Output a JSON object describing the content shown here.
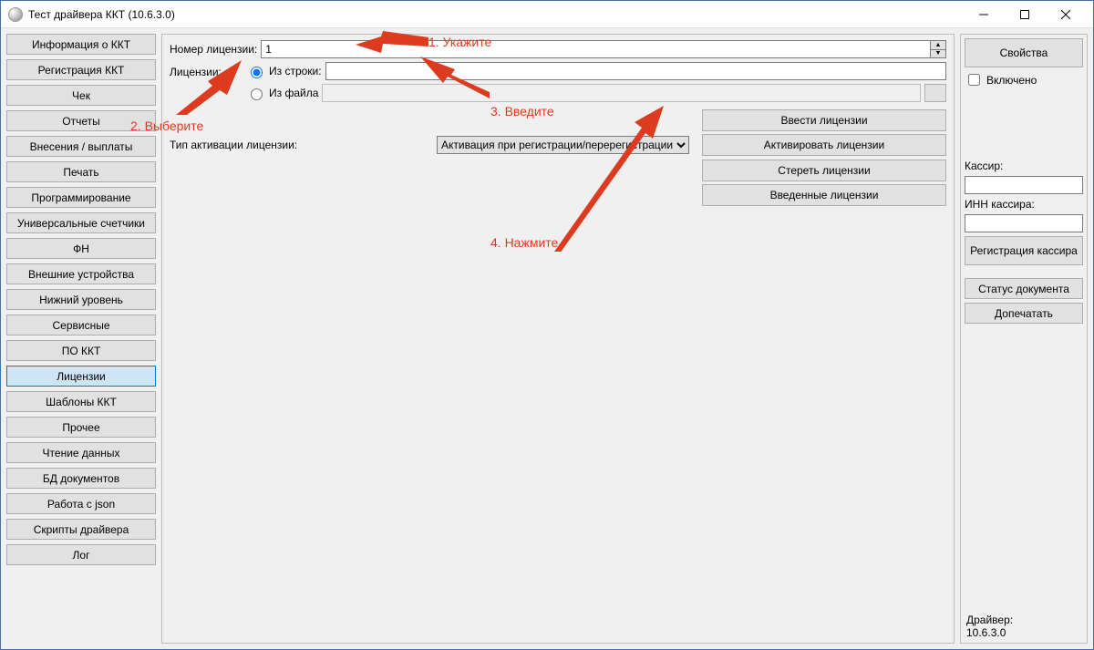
{
  "window": {
    "title": "Тест драйвера ККТ (10.6.3.0)"
  },
  "sidebar": {
    "items": [
      {
        "label": "Информация о ККТ"
      },
      {
        "label": "Регистрация ККТ"
      },
      {
        "label": "Чек"
      },
      {
        "label": "Отчеты"
      },
      {
        "label": "Внесения / выплаты"
      },
      {
        "label": "Печать"
      },
      {
        "label": "Программирование"
      },
      {
        "label": "Универсальные счетчики"
      },
      {
        "label": "ФН"
      },
      {
        "label": "Внешние устройства"
      },
      {
        "label": "Нижний уровень"
      },
      {
        "label": "Сервисные"
      },
      {
        "label": "ПО ККТ"
      },
      {
        "label": "Лицензии"
      },
      {
        "label": "Шаблоны ККТ"
      },
      {
        "label": "Прочее"
      },
      {
        "label": "Чтение данных"
      },
      {
        "label": "БД документов"
      },
      {
        "label": "Работа с json"
      },
      {
        "label": "Скрипты драйвера"
      },
      {
        "label": "Лог"
      }
    ],
    "active_index": 13
  },
  "main": {
    "license_number_label": "Номер лицензии:",
    "license_number_value": "1",
    "licenses_label": "Лицензии:",
    "radio_from_string": "Из строки:",
    "radio_from_file": "Из файла",
    "activation_type_label": "Тип активации лицензии:",
    "activation_type_value": "Активация при регистрации/перерегистрации",
    "actions": {
      "enter": "Ввести лицензии",
      "activate": "Активировать лицензии",
      "erase": "Стереть лицензии",
      "entered": "Введенные лицензии"
    }
  },
  "right": {
    "properties": "Свойства",
    "enabled": "Включено",
    "cashier_label": "Кассир:",
    "cashier_inn_label": "ИНН кассира:",
    "register_cashier": "Регистрация кассира",
    "doc_status": "Статус документа",
    "reprint": "Допечатать",
    "driver_label": "Драйвер:",
    "driver_version": "10.6.3.0"
  },
  "annotations": {
    "a1": "1. Укажите",
    "a2": "2. Выберите",
    "a3": "3. Введите",
    "a4": "4. Нажмите"
  }
}
